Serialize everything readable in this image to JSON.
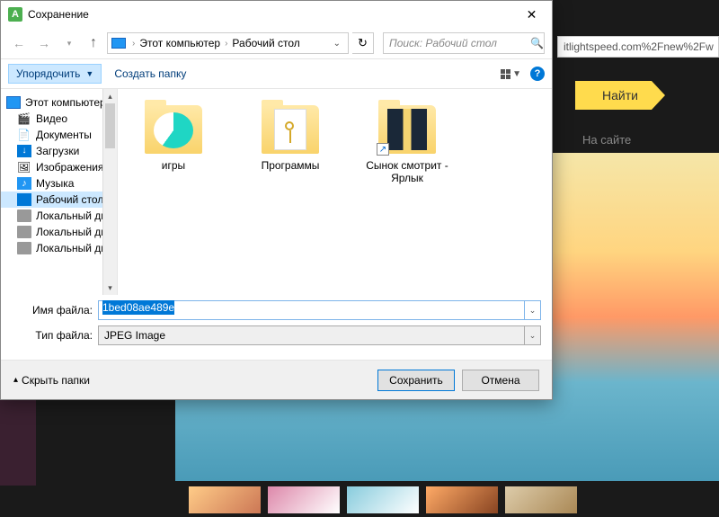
{
  "background": {
    "url_fragment": "itlightspeed.com%2Fnew%2Fw",
    "search_button": "Найти",
    "tab": "На сайте"
  },
  "dialog": {
    "title": "Сохранение",
    "path": {
      "root": "Этот компьютер",
      "current": "Рабочий стол"
    },
    "search_placeholder": "Поиск: Рабочий стол",
    "toolbar": {
      "organize": "Упорядочить",
      "new_folder": "Создать папку"
    },
    "sidebar": {
      "root": "Этот компьютер",
      "items": [
        "Видео",
        "Документы",
        "Загрузки",
        "Изображения",
        "Музыка",
        "Рабочий стол",
        "Локальный дис",
        "Локальный дис",
        "Локальный дис"
      ]
    },
    "folders": [
      {
        "name": "игры"
      },
      {
        "name": "Программы"
      },
      {
        "name": "Сынок смотрит - Ярлык"
      }
    ],
    "filename_label": "Имя файла:",
    "filename_value": "1bed08ae489e",
    "filetype_label": "Тип файла:",
    "filetype_value": "JPEG Image",
    "hide_folders": "Скрыть папки",
    "save": "Сохранить",
    "cancel": "Отмена"
  }
}
